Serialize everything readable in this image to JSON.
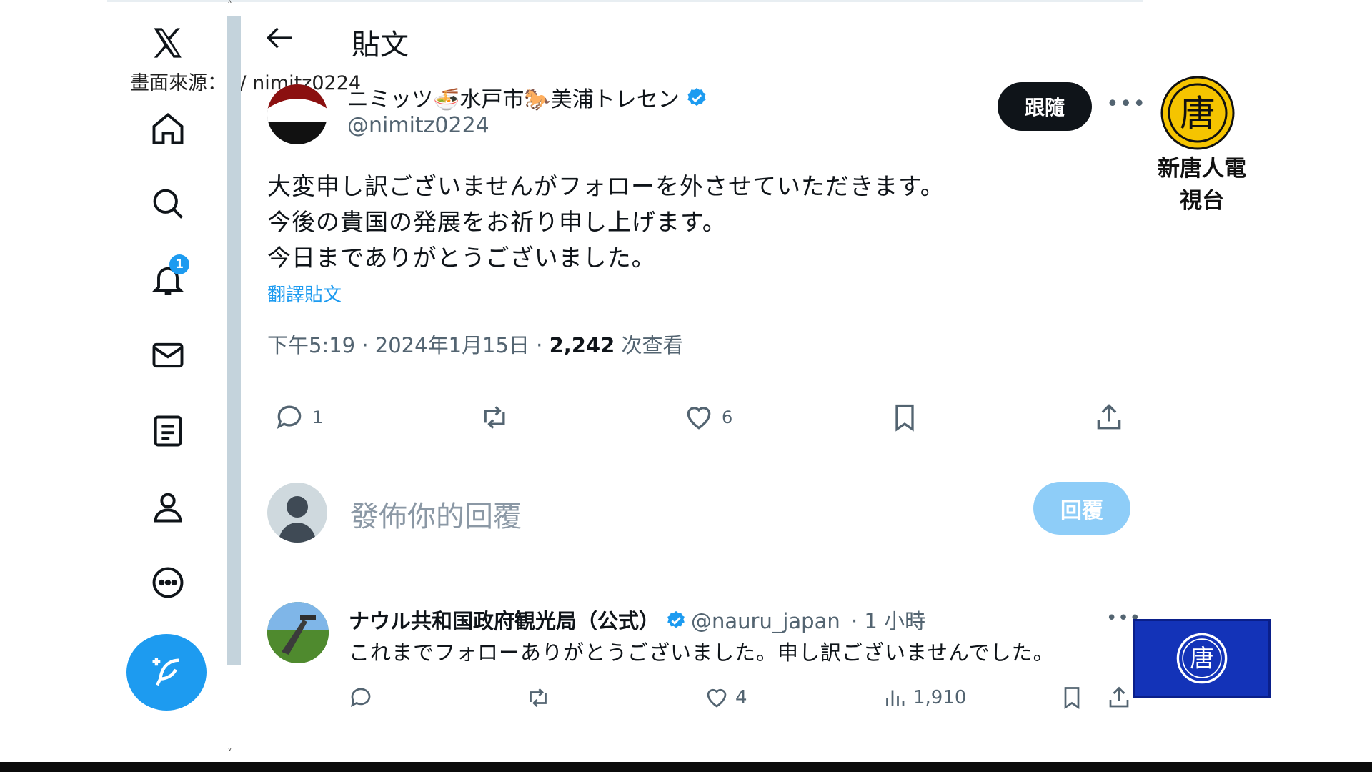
{
  "watermark": {
    "source_caption": "畫面來源：X/ nimitz0224",
    "logo_char": "唐",
    "logo_text": "新唐人電視台"
  },
  "nav": {
    "badge_count": "1"
  },
  "header": {
    "title": "貼文"
  },
  "post": {
    "author_name": "ニミッツ🍜水戸市🐎美浦トレセン",
    "author_handle": "@nimitz0224",
    "follow_label": "跟隨",
    "text_lines": [
      "大変申し訳ございませんがフォローを外させていただきます。",
      "今後の貴国の発展をお祈り申し上げます。",
      "今日までありがとうございました。"
    ],
    "translate_label": "翻譯貼文",
    "time": "下午5:19",
    "date": "2024年1月15日",
    "views": "2,242",
    "views_label": "次查看",
    "reply_count": "1",
    "like_count": "6"
  },
  "composer": {
    "placeholder": "發佈你的回覆",
    "button_label": "回覆"
  },
  "reply_tweet": {
    "name": "ナウル共和国政府観光局（公式）",
    "handle": "@nauru_japan",
    "time": "· 1 小時",
    "text": "これまでフォローありがとうございました。申し訳ございませんでした。",
    "like_count": "4",
    "views": "1,910"
  },
  "colors": {
    "accent": "#1d9bf0",
    "text": "#0f1419",
    "muted": "#536471"
  }
}
